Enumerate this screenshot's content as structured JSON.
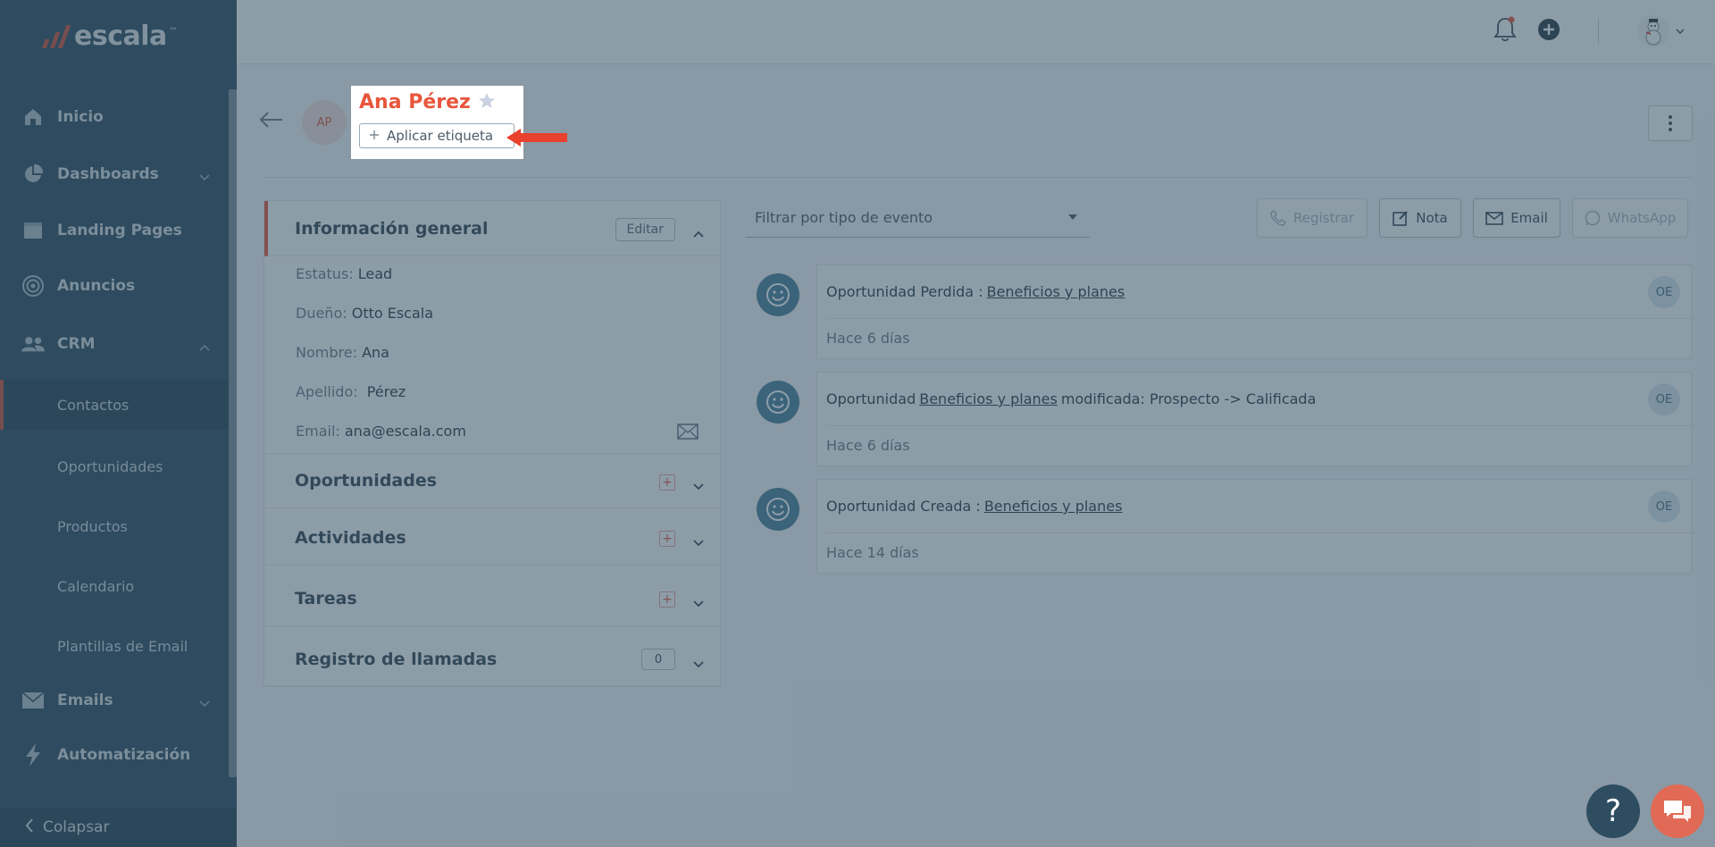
{
  "brand": {
    "name": "escala",
    "tm": "™",
    "accent": "#e8553c"
  },
  "sidebar": {
    "items": [
      {
        "label": "Inicio",
        "icon": "home-icon"
      },
      {
        "label": "Dashboards",
        "icon": "pie-chart-icon"
      },
      {
        "label": "Landing Pages",
        "icon": "window-icon"
      },
      {
        "label": "Anuncios",
        "icon": "target-icon"
      },
      {
        "label": "CRM",
        "icon": "users-icon"
      }
    ],
    "crm_sub": [
      "Contactos",
      "Oportunidades",
      "Productos",
      "Calendario",
      "Plantillas de Email"
    ],
    "bottom_items": [
      {
        "label": "Emails",
        "icon": "mail-icon"
      },
      {
        "label": "Automatización",
        "icon": "bolt-icon"
      }
    ],
    "collapse_label": "Colapsar"
  },
  "contact": {
    "initials": "AP",
    "name": "Ana Pérez",
    "apply_tag": "Aplicar etiqueta"
  },
  "info": {
    "title": "Información general",
    "edit_label": "Editar",
    "fields": [
      {
        "label": "Estatus:",
        "value": "Lead"
      },
      {
        "label": "Dueño:",
        "value": "Otto Escala"
      },
      {
        "label": "Nombre:",
        "value": "Ana"
      },
      {
        "label": "Apellido:",
        "value": "Pérez"
      },
      {
        "label": "Email:",
        "value": "ana@escala.com"
      }
    ]
  },
  "sections": {
    "oportunidades": "Oportunidades",
    "actividades": "Actividades",
    "tareas": "Tareas",
    "llamadas": "Registro de llamadas",
    "llamadas_count": "0"
  },
  "timeline": {
    "filter_placeholder": "Filtrar por tipo de evento",
    "actions": {
      "registrar": "Registrar",
      "nota": "Nota",
      "email": "Email",
      "whatsapp": "WhatsApp"
    },
    "events": [
      {
        "prefix": "Oportunidad Perdida :",
        "link": "Beneficios y planes",
        "suffix": "",
        "time": "Hace 6 días",
        "user": "OE"
      },
      {
        "prefix": "Oportunidad",
        "link": "Beneficios y planes",
        "suffix": "modificada: Prospecto -> Calificada",
        "time": "Hace 6 días",
        "user": "OE"
      },
      {
        "prefix": "Oportunidad Creada :",
        "link": "Beneficios y planes",
        "suffix": "",
        "time": "Hace 14 días",
        "user": "OE"
      }
    ]
  },
  "help_label": "?"
}
